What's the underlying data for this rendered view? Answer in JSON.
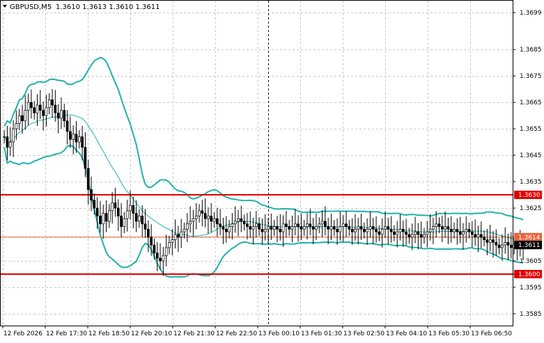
{
  "header": {
    "symbol_label": "GBPUSD,M5",
    "ohlc": "1.3610 1.3613 1.3610 1.3611"
  },
  "colors": {
    "background": "#ffffff",
    "grid": "#c8c8c8",
    "candles": "#000000",
    "bands": "#20b2aa",
    "level_lines": "#e00000",
    "bid_line": "#e8643c"
  },
  "chart_data": {
    "type": "candlestick",
    "title": "GBPUSD,M5",
    "xlabel": "",
    "ylabel": "",
    "ylim": [
      1.35805,
      1.37035
    ],
    "grid": true,
    "y_ticks": [
      "1.3699",
      "1.3685",
      "1.3675",
      "1.3665",
      "1.3655",
      "1.3645",
      "1.3635",
      "1.3625",
      "1.3614",
      "1.3605",
      "1.3600",
      "1.3595",
      "1.3585"
    ],
    "x_ticks": [
      "12 Feb 2026",
      "12 Feb 17:30",
      "12 Feb 18:50",
      "12 Feb 20:10",
      "12 Feb 21:30",
      "12 Feb 22:50",
      "13 Feb 00:10",
      "13 Feb 01:30",
      "13 Feb 02:50",
      "13 Feb 04:10",
      "13 Feb 05:30",
      "13 Feb 06:50"
    ],
    "levels": [
      {
        "value": 1.363,
        "label": "1.3630"
      },
      {
        "value": 1.36,
        "label": "1.3600"
      }
    ],
    "price_tags": {
      "bid": {
        "value": 1.3614,
        "label": "1.3614"
      },
      "last": {
        "value": 1.3611,
        "label": "1.3611"
      }
    },
    "period_separator_index": 88,
    "bars_visible": 170,
    "candles_close": [
      1.3652,
      1.3648,
      1.365,
      1.3655,
      1.3657,
      1.366,
      1.3658,
      1.3662,
      1.3665,
      1.3663,
      1.3661,
      1.3664,
      1.3662,
      1.366,
      1.3663,
      1.3666,
      1.3664,
      1.3661,
      1.3659,
      1.3662,
      1.3658,
      1.3654,
      1.3651,
      1.3653,
      1.365,
      1.3652,
      1.3648,
      1.364,
      1.3632,
      1.3628,
      1.3625,
      1.3622,
      1.3619,
      1.3623,
      1.362,
      1.3624,
      1.3627,
      1.3625,
      1.3622,
      1.3618,
      1.3621,
      1.3624,
      1.3626,
      1.3623,
      1.362,
      1.3622,
      1.3619,
      1.3617,
      1.3614,
      1.3611,
      1.3608,
      1.3606,
      1.3605,
      1.3607,
      1.361,
      1.3612,
      1.3613,
      1.3615,
      1.3614,
      1.3616,
      1.3617,
      1.3619,
      1.362,
      1.3621,
      1.3622,
      1.3624,
      1.3623,
      1.3621,
      1.3622,
      1.362,
      1.3621,
      1.3619,
      1.3618,
      1.3617,
      1.3616,
      1.3618,
      1.3619,
      1.362,
      1.3621,
      1.362,
      1.3619,
      1.3618,
      1.3617,
      1.3618,
      1.3619,
      1.3617,
      1.3616,
      1.3617,
      1.3618,
      1.3617,
      1.3618,
      1.3617,
      1.3616,
      1.3619,
      1.3618,
      1.3617,
      1.3618,
      1.3619,
      1.3618,
      1.3617,
      1.3618,
      1.3619,
      1.3618,
      1.3617,
      1.3618,
      1.3619,
      1.362,
      1.3618,
      1.3617,
      1.3618,
      1.3617,
      1.3616,
      1.3618,
      1.3619,
      1.3618,
      1.3617,
      1.3616,
      1.3617,
      1.3618,
      1.3617,
      1.3616,
      1.3617,
      1.3618,
      1.3617,
      1.3616,
      1.3615,
      1.3617,
      1.3618,
      1.3617,
      1.3616,
      1.3615,
      1.3616,
      1.3617,
      1.3616,
      1.3615,
      1.3614,
      1.3615,
      1.3616,
      1.3615,
      1.3614,
      1.3615,
      1.3616,
      1.3617,
      1.3618,
      1.3619,
      1.3618,
      1.3617,
      1.3618,
      1.3617,
      1.3616,
      1.3617,
      1.3616,
      1.3615,
      1.3616,
      1.3617,
      1.3616,
      1.3615,
      1.3614,
      1.3615,
      1.3614,
      1.3613,
      1.3612,
      1.3613,
      1.3612,
      1.3611,
      1.361,
      1.3611,
      1.3612,
      1.3611,
      1.361,
      1.3611,
      1.361,
      1.3611,
      1.3611
    ]
  }
}
